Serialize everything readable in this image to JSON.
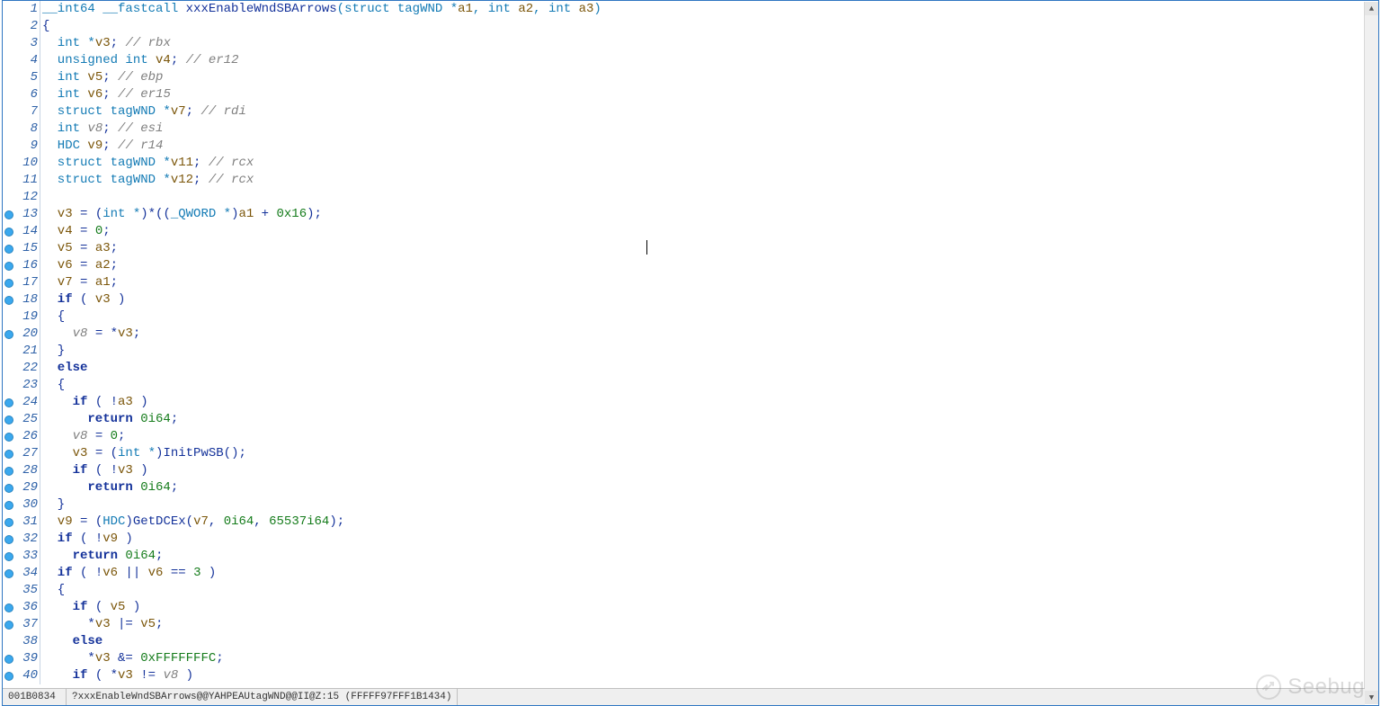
{
  "statusbar": {
    "address": "001B0834",
    "funcinfo": "?xxxEnableWndSBArrows@@YAHPEAUtagWND@@II@Z:15 (FFFFF97FFF1B1434)"
  },
  "watermark": {
    "text": "Seebug"
  },
  "lines": [
    {
      "n": 1,
      "bp": false,
      "tokens": [
        {
          "c": "t-type",
          "t": "__int64 __fastcall "
        },
        {
          "c": "t-func",
          "t": "xxxEnableWndSBArrows"
        },
        {
          "c": "t-type",
          "t": "(struct tagWND *"
        },
        {
          "c": "t-argvar",
          "t": "a1"
        },
        {
          "c": "t-type",
          "t": ", int "
        },
        {
          "c": "t-argvar",
          "t": "a2"
        },
        {
          "c": "t-type",
          "t": ", int "
        },
        {
          "c": "t-argvar",
          "t": "a3"
        },
        {
          "c": "t-type",
          "t": ")"
        }
      ]
    },
    {
      "n": 2,
      "bp": false,
      "tokens": [
        {
          "c": "t-plain",
          "t": "{"
        }
      ]
    },
    {
      "n": 3,
      "bp": false,
      "tokens": [
        {
          "c": "t-type",
          "t": "  int *"
        },
        {
          "c": "t-var",
          "t": "v3"
        },
        {
          "c": "t-plain",
          "t": "; "
        },
        {
          "c": "t-cmt",
          "t": "// rbx"
        }
      ]
    },
    {
      "n": 4,
      "bp": false,
      "tokens": [
        {
          "c": "t-type",
          "t": "  unsigned int "
        },
        {
          "c": "t-var",
          "t": "v4"
        },
        {
          "c": "t-plain",
          "t": "; "
        },
        {
          "c": "t-cmt",
          "t": "// er12"
        }
      ]
    },
    {
      "n": 5,
      "bp": false,
      "tokens": [
        {
          "c": "t-type",
          "t": "  int "
        },
        {
          "c": "t-var",
          "t": "v5"
        },
        {
          "c": "t-plain",
          "t": "; "
        },
        {
          "c": "t-cmt",
          "t": "// ebp"
        }
      ]
    },
    {
      "n": 6,
      "bp": false,
      "tokens": [
        {
          "c": "t-type",
          "t": "  int "
        },
        {
          "c": "t-var",
          "t": "v6"
        },
        {
          "c": "t-plain",
          "t": "; "
        },
        {
          "c": "t-cmt",
          "t": "// er15"
        }
      ]
    },
    {
      "n": 7,
      "bp": false,
      "tokens": [
        {
          "c": "t-type",
          "t": "  struct tagWND *"
        },
        {
          "c": "t-var",
          "t": "v7"
        },
        {
          "c": "t-plain",
          "t": "; "
        },
        {
          "c": "t-cmt",
          "t": "// rdi"
        }
      ]
    },
    {
      "n": 8,
      "bp": false,
      "tokens": [
        {
          "c": "t-type",
          "t": "  int "
        },
        {
          "c": "t-cmt",
          "t": "v8"
        },
        {
          "c": "t-plain",
          "t": "; "
        },
        {
          "c": "t-cmt",
          "t": "// esi"
        }
      ]
    },
    {
      "n": 9,
      "bp": false,
      "tokens": [
        {
          "c": "t-type",
          "t": "  HDC "
        },
        {
          "c": "t-var",
          "t": "v9"
        },
        {
          "c": "t-plain",
          "t": "; "
        },
        {
          "c": "t-cmt",
          "t": "// r14"
        }
      ]
    },
    {
      "n": 10,
      "bp": false,
      "tokens": [
        {
          "c": "t-type",
          "t": "  struct tagWND *"
        },
        {
          "c": "t-var",
          "t": "v11"
        },
        {
          "c": "t-plain",
          "t": "; "
        },
        {
          "c": "t-cmt",
          "t": "// rcx"
        }
      ]
    },
    {
      "n": 11,
      "bp": false,
      "tokens": [
        {
          "c": "t-type",
          "t": "  struct tagWND *"
        },
        {
          "c": "t-var",
          "t": "v12"
        },
        {
          "c": "t-plain",
          "t": "; "
        },
        {
          "c": "t-cmt",
          "t": "// rcx"
        }
      ]
    },
    {
      "n": 12,
      "bp": false,
      "tokens": [
        {
          "c": "t-plain",
          "t": ""
        }
      ]
    },
    {
      "n": 13,
      "bp": true,
      "tokens": [
        {
          "c": "t-var",
          "t": "  v3"
        },
        {
          "c": "t-plain",
          "t": " = ("
        },
        {
          "c": "t-type",
          "t": "int *"
        },
        {
          "c": "t-plain",
          "t": ")*(("
        },
        {
          "c": "t-type",
          "t": "_QWORD *"
        },
        {
          "c": "t-plain",
          "t": ")"
        },
        {
          "c": "t-argvar",
          "t": "a1"
        },
        {
          "c": "t-plain",
          "t": " + "
        },
        {
          "c": "t-num",
          "t": "0x16"
        },
        {
          "c": "t-plain",
          "t": ");"
        }
      ]
    },
    {
      "n": 14,
      "bp": true,
      "tokens": [
        {
          "c": "t-var",
          "t": "  v4"
        },
        {
          "c": "t-plain",
          "t": " = "
        },
        {
          "c": "t-num",
          "t": "0"
        },
        {
          "c": "t-plain",
          "t": ";"
        }
      ]
    },
    {
      "n": 15,
      "bp": true,
      "cursor_after": true,
      "tokens": [
        {
          "c": "t-var",
          "t": "  v5"
        },
        {
          "c": "t-plain",
          "t": " = "
        },
        {
          "c": "t-argvar",
          "t": "a3"
        },
        {
          "c": "t-plain",
          "t": ";"
        }
      ]
    },
    {
      "n": 16,
      "bp": true,
      "tokens": [
        {
          "c": "t-var",
          "t": "  v6"
        },
        {
          "c": "t-plain",
          "t": " = "
        },
        {
          "c": "t-argvar",
          "t": "a2"
        },
        {
          "c": "t-plain",
          "t": ";"
        }
      ]
    },
    {
      "n": 17,
      "bp": true,
      "tokens": [
        {
          "c": "t-var",
          "t": "  v7"
        },
        {
          "c": "t-plain",
          "t": " = "
        },
        {
          "c": "t-argvar",
          "t": "a1"
        },
        {
          "c": "t-plain",
          "t": ";"
        }
      ]
    },
    {
      "n": 18,
      "bp": true,
      "tokens": [
        {
          "c": "t-kw",
          "t": "  if"
        },
        {
          "c": "t-plain",
          "t": " ( "
        },
        {
          "c": "t-var",
          "t": "v3"
        },
        {
          "c": "t-plain",
          "t": " )"
        }
      ]
    },
    {
      "n": 19,
      "bp": false,
      "tokens": [
        {
          "c": "t-plain",
          "t": "  {"
        }
      ]
    },
    {
      "n": 20,
      "bp": true,
      "tokens": [
        {
          "c": "t-plain",
          "t": "    "
        },
        {
          "c": "t-cmt",
          "t": "v8"
        },
        {
          "c": "t-plain",
          "t": " = *"
        },
        {
          "c": "t-var",
          "t": "v3"
        },
        {
          "c": "t-plain",
          "t": ";"
        }
      ]
    },
    {
      "n": 21,
      "bp": false,
      "tokens": [
        {
          "c": "t-plain",
          "t": "  }"
        }
      ]
    },
    {
      "n": 22,
      "bp": false,
      "tokens": [
        {
          "c": "t-kw",
          "t": "  else"
        }
      ]
    },
    {
      "n": 23,
      "bp": false,
      "tokens": [
        {
          "c": "t-plain",
          "t": "  {"
        }
      ]
    },
    {
      "n": 24,
      "bp": true,
      "tokens": [
        {
          "c": "t-kw",
          "t": "    if"
        },
        {
          "c": "t-plain",
          "t": " ( !"
        },
        {
          "c": "t-argvar",
          "t": "a3"
        },
        {
          "c": "t-plain",
          "t": " )"
        }
      ]
    },
    {
      "n": 25,
      "bp": true,
      "tokens": [
        {
          "c": "t-kw",
          "t": "      return "
        },
        {
          "c": "t-num",
          "t": "0i64"
        },
        {
          "c": "t-plain",
          "t": ";"
        }
      ]
    },
    {
      "n": 26,
      "bp": true,
      "tokens": [
        {
          "c": "t-plain",
          "t": "    "
        },
        {
          "c": "t-cmt",
          "t": "v8"
        },
        {
          "c": "t-plain",
          "t": " = "
        },
        {
          "c": "t-num",
          "t": "0"
        },
        {
          "c": "t-plain",
          "t": ";"
        }
      ]
    },
    {
      "n": 27,
      "bp": true,
      "tokens": [
        {
          "c": "t-var",
          "t": "    v3"
        },
        {
          "c": "t-plain",
          "t": " = ("
        },
        {
          "c": "t-type",
          "t": "int *"
        },
        {
          "c": "t-plain",
          "t": ")"
        },
        {
          "c": "t-func",
          "t": "InitPwSB"
        },
        {
          "c": "t-plain",
          "t": "();"
        }
      ]
    },
    {
      "n": 28,
      "bp": true,
      "tokens": [
        {
          "c": "t-kw",
          "t": "    if"
        },
        {
          "c": "t-plain",
          "t": " ( !"
        },
        {
          "c": "t-var",
          "t": "v3"
        },
        {
          "c": "t-plain",
          "t": " )"
        }
      ]
    },
    {
      "n": 29,
      "bp": true,
      "tokens": [
        {
          "c": "t-kw",
          "t": "      return "
        },
        {
          "c": "t-num",
          "t": "0i64"
        },
        {
          "c": "t-plain",
          "t": ";"
        }
      ]
    },
    {
      "n": 30,
      "bp": true,
      "tokens": [
        {
          "c": "t-plain",
          "t": "  }"
        }
      ]
    },
    {
      "n": 31,
      "bp": true,
      "tokens": [
        {
          "c": "t-var",
          "t": "  v9"
        },
        {
          "c": "t-plain",
          "t": " = ("
        },
        {
          "c": "t-type",
          "t": "HDC"
        },
        {
          "c": "t-plain",
          "t": ")"
        },
        {
          "c": "t-func",
          "t": "GetDCEx"
        },
        {
          "c": "t-plain",
          "t": "("
        },
        {
          "c": "t-var",
          "t": "v7"
        },
        {
          "c": "t-plain",
          "t": ", "
        },
        {
          "c": "t-num",
          "t": "0i64"
        },
        {
          "c": "t-plain",
          "t": ", "
        },
        {
          "c": "t-num",
          "t": "65537i64"
        },
        {
          "c": "t-plain",
          "t": ");"
        }
      ]
    },
    {
      "n": 32,
      "bp": true,
      "tokens": [
        {
          "c": "t-kw",
          "t": "  if"
        },
        {
          "c": "t-plain",
          "t": " ( !"
        },
        {
          "c": "t-var",
          "t": "v9"
        },
        {
          "c": "t-plain",
          "t": " )"
        }
      ]
    },
    {
      "n": 33,
      "bp": true,
      "tokens": [
        {
          "c": "t-kw",
          "t": "    return "
        },
        {
          "c": "t-num",
          "t": "0i64"
        },
        {
          "c": "t-plain",
          "t": ";"
        }
      ]
    },
    {
      "n": 34,
      "bp": true,
      "tokens": [
        {
          "c": "t-kw",
          "t": "  if"
        },
        {
          "c": "t-plain",
          "t": " ( !"
        },
        {
          "c": "t-var",
          "t": "v6"
        },
        {
          "c": "t-plain",
          "t": " || "
        },
        {
          "c": "t-var",
          "t": "v6"
        },
        {
          "c": "t-plain",
          "t": " == "
        },
        {
          "c": "t-num",
          "t": "3"
        },
        {
          "c": "t-plain",
          "t": " )"
        }
      ]
    },
    {
      "n": 35,
      "bp": false,
      "tokens": [
        {
          "c": "t-plain",
          "t": "  {"
        }
      ]
    },
    {
      "n": 36,
      "bp": true,
      "tokens": [
        {
          "c": "t-kw",
          "t": "    if"
        },
        {
          "c": "t-plain",
          "t": " ( "
        },
        {
          "c": "t-var",
          "t": "v5"
        },
        {
          "c": "t-plain",
          "t": " )"
        }
      ]
    },
    {
      "n": 37,
      "bp": true,
      "tokens": [
        {
          "c": "t-plain",
          "t": "      *"
        },
        {
          "c": "t-var",
          "t": "v3"
        },
        {
          "c": "t-plain",
          "t": " |= "
        },
        {
          "c": "t-var",
          "t": "v5"
        },
        {
          "c": "t-plain",
          "t": ";"
        }
      ]
    },
    {
      "n": 38,
      "bp": false,
      "tokens": [
        {
          "c": "t-kw",
          "t": "    else"
        }
      ]
    },
    {
      "n": 39,
      "bp": true,
      "tokens": [
        {
          "c": "t-plain",
          "t": "      *"
        },
        {
          "c": "t-var",
          "t": "v3"
        },
        {
          "c": "t-plain",
          "t": " &= "
        },
        {
          "c": "t-num",
          "t": "0xFFFFFFFC"
        },
        {
          "c": "t-plain",
          "t": ";"
        }
      ]
    },
    {
      "n": 40,
      "bp": true,
      "tokens": [
        {
          "c": "t-kw",
          "t": "    if"
        },
        {
          "c": "t-plain",
          "t": " ( *"
        },
        {
          "c": "t-var",
          "t": "v3"
        },
        {
          "c": "t-plain",
          "t": " != "
        },
        {
          "c": "t-cmt",
          "t": "v8"
        },
        {
          "c": "t-plain",
          "t": " )"
        }
      ]
    }
  ]
}
